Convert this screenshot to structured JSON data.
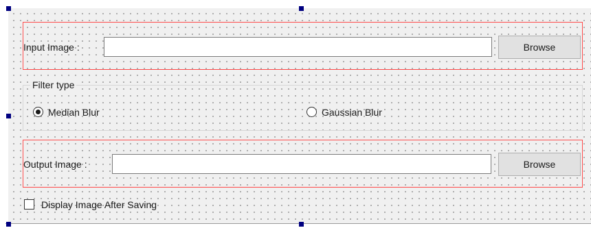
{
  "form": {
    "input_image": {
      "label": "Input Image :",
      "value": "",
      "browse_label": "Browse"
    },
    "filter_type": {
      "title": "Filter type",
      "options": [
        {
          "label": "Median Blur",
          "checked": true
        },
        {
          "label": "Gaussian Blur",
          "checked": false
        }
      ]
    },
    "output_image": {
      "label": "Output Image :",
      "value": "",
      "browse_label": "Browse"
    },
    "display_after_saving": {
      "label": "Display Image After Saving",
      "checked": false
    }
  },
  "colors": {
    "layout_border": "#ff4a4a",
    "selection_handle": "#000080",
    "canvas_background": "#f0f0f0",
    "button_face": "#e1e1e1"
  },
  "icons": {
    "selection_handles": "selection-handle-icon"
  }
}
